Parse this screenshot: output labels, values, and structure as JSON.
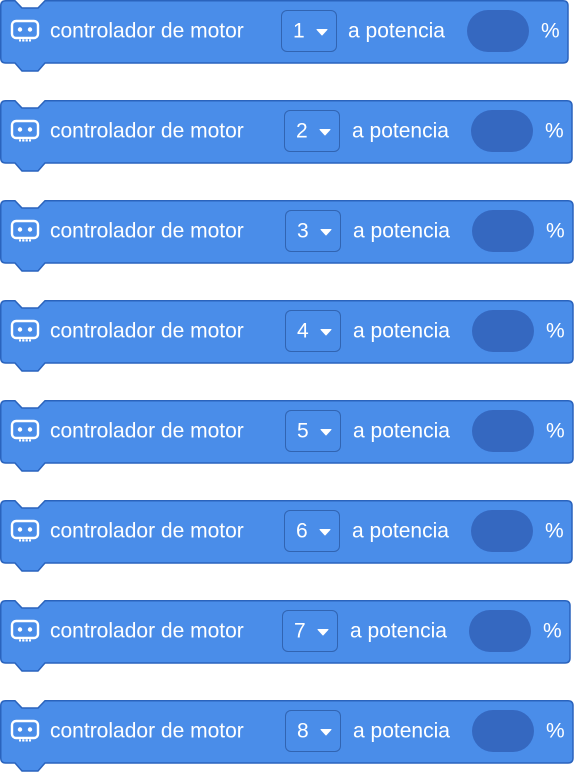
{
  "colors": {
    "block_fill": "#4a8de9",
    "block_border": "#2a63bd",
    "slot_fill": "#3568c0",
    "text": "#ffffff"
  },
  "blocks": [
    {
      "label": "controlador de motor",
      "motor": "1",
      "power_label": "a potencia",
      "power_value": "",
      "unit": "%",
      "icon": "microbit-icon"
    },
    {
      "label": "controlador de motor",
      "motor": "2",
      "power_label": "a potencia",
      "power_value": "",
      "unit": "%",
      "icon": "microbit-icon"
    },
    {
      "label": "controlador de motor",
      "motor": "3",
      "power_label": "a potencia",
      "power_value": "",
      "unit": "%",
      "icon": "microbit-icon"
    },
    {
      "label": "controlador de motor",
      "motor": "4",
      "power_label": "a potencia",
      "power_value": "",
      "unit": "%",
      "icon": "microbit-icon"
    },
    {
      "label": "controlador de motor",
      "motor": "5",
      "power_label": "a potencia",
      "power_value": "",
      "unit": "%",
      "icon": "microbit-icon"
    },
    {
      "label": "controlador de motor",
      "motor": "6",
      "power_label": "a potencia",
      "power_value": "",
      "unit": "%",
      "icon": "microbit-icon"
    },
    {
      "label": "controlador de motor",
      "motor": "7",
      "power_label": "a potencia",
      "power_value": "",
      "unit": "%",
      "icon": "microbit-icon"
    },
    {
      "label": "controlador de motor",
      "motor": "8",
      "power_label": "a potencia",
      "power_value": "",
      "unit": "%",
      "icon": "microbit-icon"
    }
  ]
}
